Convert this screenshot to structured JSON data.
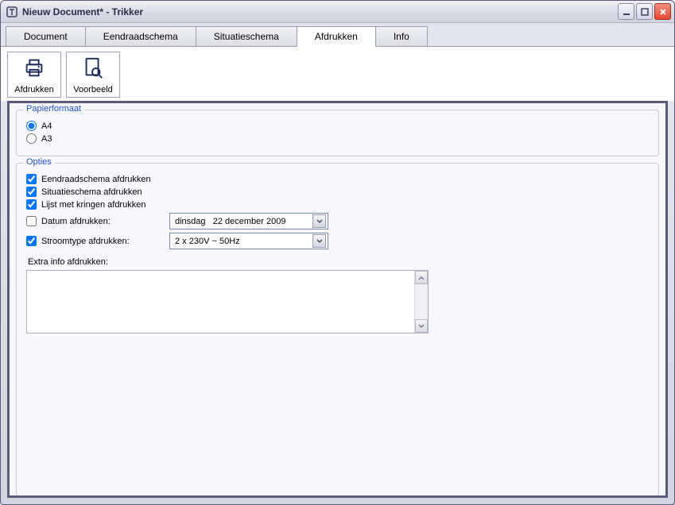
{
  "window": {
    "title": "Nieuw Document* - Trikker"
  },
  "tabs": {
    "document": "Document",
    "eendraadschema": "Eendraadschema",
    "situatieschema": "Situatieschema",
    "afdrukken": "Afdrukken",
    "info": "Info"
  },
  "toolbar": {
    "print": "Afdrukken",
    "preview": "Voorbeeld"
  },
  "group_paper": {
    "legend": "Papierformaat",
    "a4": "A4",
    "a3": "A3"
  },
  "group_options": {
    "legend": "Opties",
    "eendraad": "Eendraadschema afdrukken",
    "situatie": "Situatieschema afdrukken",
    "kringen": "Lijst met kringen afdrukken",
    "datum_label": "Datum afdrukken:",
    "datum_value": "dinsdag   22 december 2009",
    "stroom_label": "Stroomtype afdrukken:",
    "stroom_value": "2 x 230V ~ 50Hz",
    "extra_label": "Extra info afdrukken:"
  }
}
